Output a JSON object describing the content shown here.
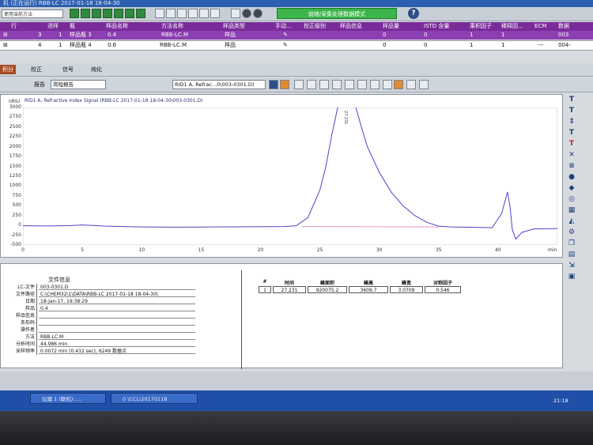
{
  "window": {
    "title": "RBB-LC 2017-01-18 18-04-30",
    "title_prefix": "机 (正在运行)"
  },
  "toolbar": {
    "method_value": "使用当前方法",
    "mode_banner": "就绪/采集处理数据模式",
    "help_label": "?"
  },
  "sequence": {
    "headers": [
      "行",
      "进样",
      "瓶",
      "样品名称",
      "方法名称",
      "样品类型",
      "手动...",
      "校正级别",
      "样品信息",
      "样品量",
      "ISTD 含量",
      "乘积因子",
      "稀释因...",
      "ECM",
      "数据"
    ],
    "rows": [
      [
        "3",
        "1",
        "样品瓶 3",
        "0.4",
        "RBB-LC.M",
        "样品",
        "",
        "",
        "",
        "0",
        "0",
        "1",
        "1",
        "",
        "003"
      ],
      [
        "4",
        "1",
        "样品瓶 4",
        "0.6",
        "RBB-LC.M",
        "样品",
        "",
        "",
        "",
        "0",
        "0",
        "1",
        "1",
        "---",
        "004-"
      ]
    ]
  },
  "tabs": [
    {
      "label": "积分"
    },
    {
      "label": "校正"
    },
    {
      "label": "信号"
    },
    {
      "label": "纯化"
    }
  ],
  "toolbar2": {
    "report_label": "报告",
    "report_value": "简短报告",
    "signal_select": "RID1 A, Refrac...0\\003-0301.D)"
  },
  "chart_data": {
    "type": "line",
    "title": "RID1 A, Refractive Index Signal (RBB-LC 2017-01-18 18-04-30\\003-0301.D)",
    "ylabel": "nRIU",
    "xlabel": "min",
    "xlim": [
      0,
      45
    ],
    "ylim": [
      -500,
      3000
    ],
    "x_ticks": [
      0,
      5,
      10,
      15,
      20,
      25,
      30,
      35,
      40
    ],
    "y_ticks": [
      -500,
      -250,
      0,
      250,
      500,
      750,
      1000,
      1250,
      1500,
      1750,
      2000,
      2250,
      2500,
      2750,
      3000
    ],
    "peak_label": "27.231",
    "series": [
      {
        "color": "#4a44c8",
        "x": [
          0,
          2,
          4,
          5,
          7,
          10,
          13,
          16,
          19,
          22,
          23,
          24,
          25,
          25.5,
          26,
          26.5,
          27.0,
          27.23,
          27.5,
          28,
          28.5,
          29,
          30,
          31,
          32,
          33,
          34,
          35,
          36,
          38,
          39.5,
          40.3,
          40.8,
          41.0,
          41.2,
          41.5,
          42,
          43,
          45
        ],
        "y": [
          -10,
          -15,
          -5,
          10,
          -20,
          -40,
          -45,
          -40,
          -35,
          -30,
          -10,
          200,
          900,
          1500,
          2300,
          3000,
          3450,
          3610,
          3500,
          3050,
          2500,
          2000,
          1350,
          850,
          500,
          250,
          80,
          -20,
          -40,
          -50,
          -60,
          300,
          850,
          500,
          -100,
          -350,
          -180,
          -90,
          -80
        ]
      },
      {
        "color": "#e36fb0",
        "x": [
          23.5,
          35
        ],
        "y": [
          -30,
          -40
        ]
      }
    ]
  },
  "file_info": {
    "title": "文件信息",
    "rows": [
      {
        "label": "LC-文件",
        "value": "003-0301.D"
      },
      {
        "label": "文件路径",
        "value": "C:\\CHEM32\\1\\DATA\\RBB-LC 2017-01-18 18-04-30\\"
      },
      {
        "label": "日期",
        "value": "18-Jan-17, 19:38:29"
      },
      {
        "label": "样品",
        "value": "0.4"
      },
      {
        "label": "样品信息",
        "value": ""
      },
      {
        "label": "条形码",
        "value": ""
      },
      {
        "label": "操作者",
        "value": ""
      },
      {
        "label": "方法",
        "value": "RBB-LC.M"
      },
      {
        "label": "分析时间",
        "value": "44.986 min"
      },
      {
        "label": "采样频率",
        "value": "0.0072 min (0.432 sec), 6249 数据点"
      }
    ]
  },
  "results": {
    "headers": [
      "#",
      "时间",
      "峰面积",
      "峰高",
      "峰宽",
      "对称因子"
    ],
    "row": [
      "1",
      "27.231",
      "920075.2",
      "3609.7",
      "3.0709",
      "0.546"
    ]
  },
  "taskbar": {
    "item1": "仪器 1 (联机): ...",
    "item2": "0 \\CCL\\20170118",
    "clock": "21:18"
  }
}
